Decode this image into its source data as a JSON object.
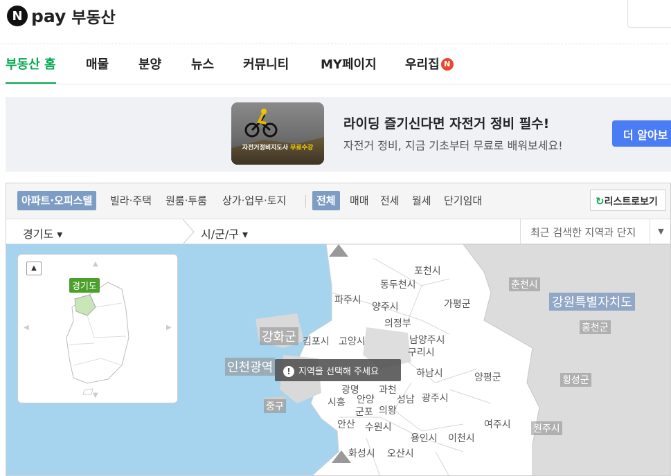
{
  "header": {
    "logo_letter": "N",
    "logo_pay": "pay",
    "service": "부동산"
  },
  "nav": [
    {
      "label": "부동산 홈",
      "active": true
    },
    {
      "label": "매물"
    },
    {
      "label": "분양"
    },
    {
      "label": "뉴스"
    },
    {
      "label": "커뮤니티"
    },
    {
      "label": "MY페이지"
    },
    {
      "label": "우리집",
      "badge": "N"
    }
  ],
  "banner": {
    "thumb_caption_a": "자전거정비지도사",
    "thumb_caption_b": "무료수강",
    "title": "라이딩 즐기신다면 자전거 정비 필수!",
    "desc": "자전거 정비, 지금 기초부터 무료로 배워보세요!",
    "cta": "더 알아보"
  },
  "filters": {
    "types": [
      "아파트·오피스텔",
      "빌라·주택",
      "원룸·투룸",
      "상가·업무·토지"
    ],
    "deals": [
      "전체",
      "매매",
      "전세",
      "월세",
      "단기임대"
    ],
    "list_view": "리스트로보기"
  },
  "location": {
    "province": "경기도 ▾",
    "city": "시/군/구 ▾",
    "recent": "최근 검색한 지역과 단지",
    "dropdown_icon": "▼"
  },
  "minimap": {
    "tag": "경기도",
    "collapse_icon": "▲"
  },
  "toast": {
    "icon": "!",
    "text": "지역을 선택해 주세요"
  },
  "map_labels": [
    "포천시",
    "동두천시",
    "파주시",
    "양주시",
    "가평군",
    "의정부",
    "강화군",
    "김포시",
    "고양시",
    "남양주시",
    "구리시",
    "인천광역",
    "하남시",
    "양평군",
    "광명",
    "과천",
    "성남",
    "시흥",
    "안양",
    "군포",
    "의왕",
    "광주시",
    "중구",
    "안산",
    "수원시",
    "여주시",
    "용인시",
    "이천시",
    "화성시",
    "오산시",
    "춘천시",
    "강원특별자치도",
    "홍천군",
    "횡성군",
    "원주시"
  ],
  "colors": {
    "accent": "#03a94d",
    "sea": "#a6d4ee",
    "cta": "#4a7cf3",
    "filter_selected": "#7d9dc4"
  }
}
